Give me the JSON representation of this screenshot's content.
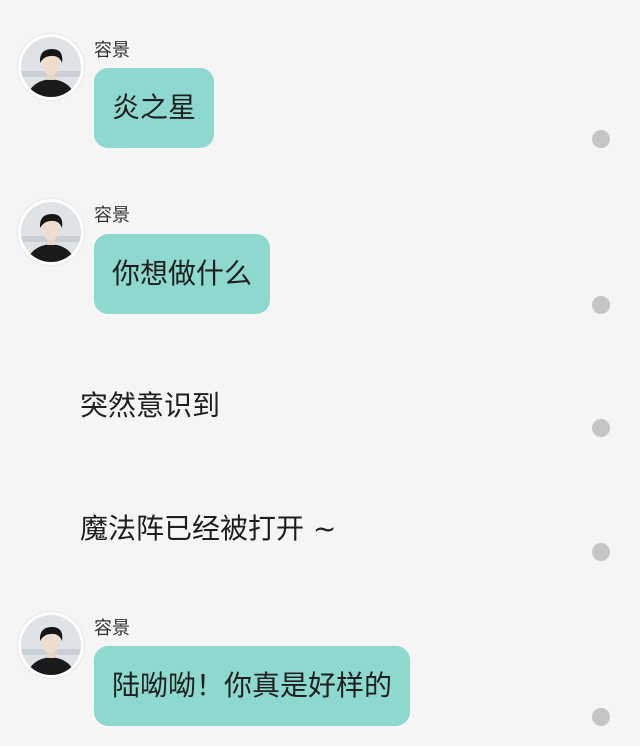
{
  "colors": {
    "background": "#f5f5f5",
    "bubble": "#8ed9cf",
    "dot": "#c5c5c5",
    "text": "#1e1e1e"
  },
  "messages": [
    {
      "type": "bubble",
      "sender": "容景",
      "text": "炎之星",
      "avatar_icon": "avatar-icon"
    },
    {
      "type": "bubble",
      "sender": "容景",
      "text": "你想做什么",
      "avatar_icon": "avatar-icon"
    },
    {
      "type": "narration",
      "text": "突然意识到"
    },
    {
      "type": "narration",
      "text": "魔法阵已经被打开 ~"
    },
    {
      "type": "bubble",
      "sender": "容景",
      "text": "陆呦呦！你真是好样的",
      "avatar_icon": "avatar-icon"
    }
  ]
}
